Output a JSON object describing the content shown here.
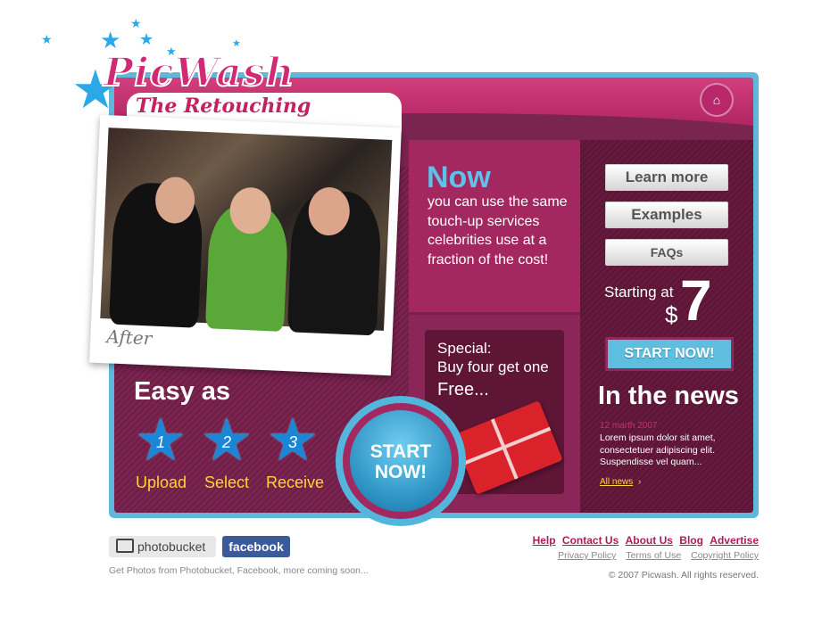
{
  "brand": {
    "name": "PicWash",
    "tagline": "The Retouching Revolution"
  },
  "hero": {
    "photo_caption": "After",
    "now_title": "Now",
    "now_text": "you can use the same touch-up services celebrities use at a fraction of the cost!"
  },
  "special": {
    "line1": "Special:",
    "line2": "Buy four get one",
    "line3": "Free..."
  },
  "steps": {
    "title": "Easy as",
    "items": [
      {
        "number": "1",
        "label": "Upload"
      },
      {
        "number": "2",
        "label": "Select"
      },
      {
        "number": "3",
        "label": "Receive"
      }
    ]
  },
  "cta": {
    "big_start_line1": "START",
    "big_start_line2": "NOW!",
    "small_start": "START NOW!"
  },
  "nav_buttons": {
    "learn_more": "Learn more",
    "examples": "Examples",
    "faqs": "FAQs"
  },
  "pricing": {
    "starting_at": "Starting at",
    "currency": "$",
    "price": "7"
  },
  "news": {
    "title": "In the news",
    "date": "12 marth 2007",
    "text": "Lorem ipsum dolor sit amet, consectetuer adipiscing elit. Suspendisse vel quam...",
    "all_news": "All news"
  },
  "footer": {
    "photobucket": "photobucket",
    "facebook": "facebook",
    "note": "Get Photos from Photobucket, Facebook, more coming soon...",
    "links": [
      "Help",
      "Contact Us",
      "About Us",
      "Blog",
      "Advertise"
    ],
    "legal_links": [
      "Privacy Policy",
      "Terms of Use",
      "Copyright Policy"
    ],
    "copyright": "© 2007 Picwash. All rights reserved."
  },
  "colors": {
    "brand_pink": "#a81d5c",
    "accent_blue": "#5fb8dc",
    "highlight_yellow": "#ffd33a"
  }
}
